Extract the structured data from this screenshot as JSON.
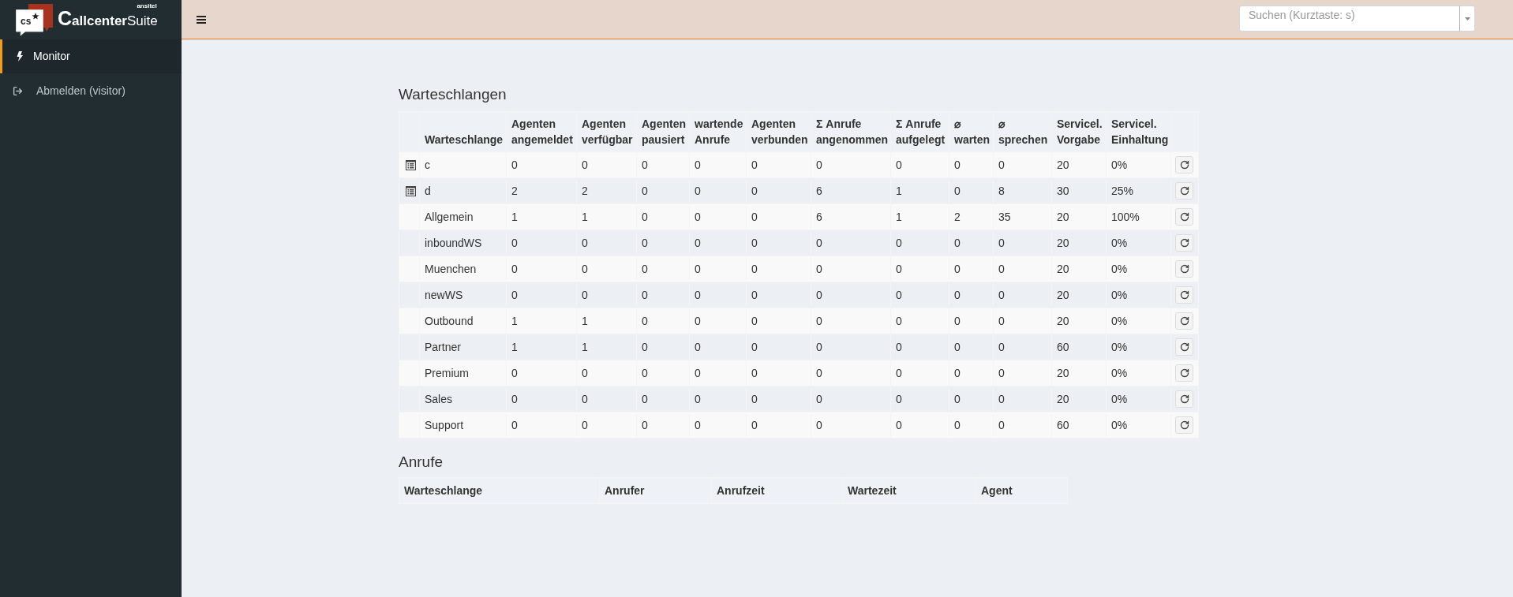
{
  "brand": {
    "mark": "cs",
    "name": "**Callcenter**Suite",
    "vendor": "ansitel"
  },
  "sidebar": {
    "items": [
      {
        "label": "Monitor",
        "selected": true
      },
      {
        "label": "Abmelden (visitor)",
        "selected": false
      }
    ]
  },
  "topbar": {
    "search": {
      "placeholder": "Suchen (Kurztaste: s)"
    }
  },
  "queues": {
    "title": "Warteschlangen",
    "columns": [
      "Warteschlange",
      "Agenten\nangemeldet",
      "Agenten\nverfügbar",
      "Agenten\npausiert",
      "wartende\nAnrufe",
      "Agenten\nverbunden",
      "Σ Anrufe\nangenommen",
      "Σ Anrufe\naufgelegt",
      "⌀\nwarten",
      "⌀\nsprechen",
      "Servicel.\nVorgabe",
      "Servicel.\nEinhaltung"
    ],
    "rows": [
      {
        "has_details": true,
        "cells": [
          "c",
          "0",
          "0",
          "0",
          "0",
          "0",
          "0",
          "0",
          "0",
          "0",
          "20",
          "0%"
        ]
      },
      {
        "has_details": true,
        "cells": [
          "d",
          "2",
          "2",
          "0",
          "0",
          "0",
          "6",
          "1",
          "0",
          "8",
          "30",
          "25%"
        ]
      },
      {
        "has_details": false,
        "cells": [
          "Allgemein",
          "1",
          "1",
          "0",
          "0",
          "0",
          "6",
          "1",
          "2",
          "35",
          "20",
          "100%"
        ]
      },
      {
        "has_details": false,
        "cells": [
          "inboundWS",
          "0",
          "0",
          "0",
          "0",
          "0",
          "0",
          "0",
          "0",
          "0",
          "20",
          "0%"
        ]
      },
      {
        "has_details": false,
        "cells": [
          "Muenchen",
          "0",
          "0",
          "0",
          "0",
          "0",
          "0",
          "0",
          "0",
          "0",
          "20",
          "0%"
        ]
      },
      {
        "has_details": false,
        "cells": [
          "newWS",
          "0",
          "0",
          "0",
          "0",
          "0",
          "0",
          "0",
          "0",
          "0",
          "20",
          "0%"
        ]
      },
      {
        "has_details": false,
        "cells": [
          "Outbound",
          "1",
          "1",
          "0",
          "0",
          "0",
          "0",
          "0",
          "0",
          "0",
          "20",
          "0%"
        ]
      },
      {
        "has_details": false,
        "cells": [
          "Partner",
          "1",
          "1",
          "0",
          "0",
          "0",
          "0",
          "0",
          "0",
          "0",
          "60",
          "0%"
        ]
      },
      {
        "has_details": false,
        "cells": [
          "Premium",
          "0",
          "0",
          "0",
          "0",
          "0",
          "0",
          "0",
          "0",
          "0",
          "20",
          "0%"
        ]
      },
      {
        "has_details": false,
        "cells": [
          "Sales",
          "0",
          "0",
          "0",
          "0",
          "0",
          "0",
          "0",
          "0",
          "0",
          "20",
          "0%"
        ]
      },
      {
        "has_details": false,
        "cells": [
          "Support",
          "0",
          "0",
          "0",
          "0",
          "0",
          "0",
          "0",
          "0",
          "0",
          "60",
          "0%"
        ]
      }
    ]
  },
  "calls": {
    "title": "Anrufe",
    "columns": [
      "Warteschlange",
      "Anrufer",
      "Anrufzeit",
      "Wartezeit",
      "Agent"
    ]
  }
}
